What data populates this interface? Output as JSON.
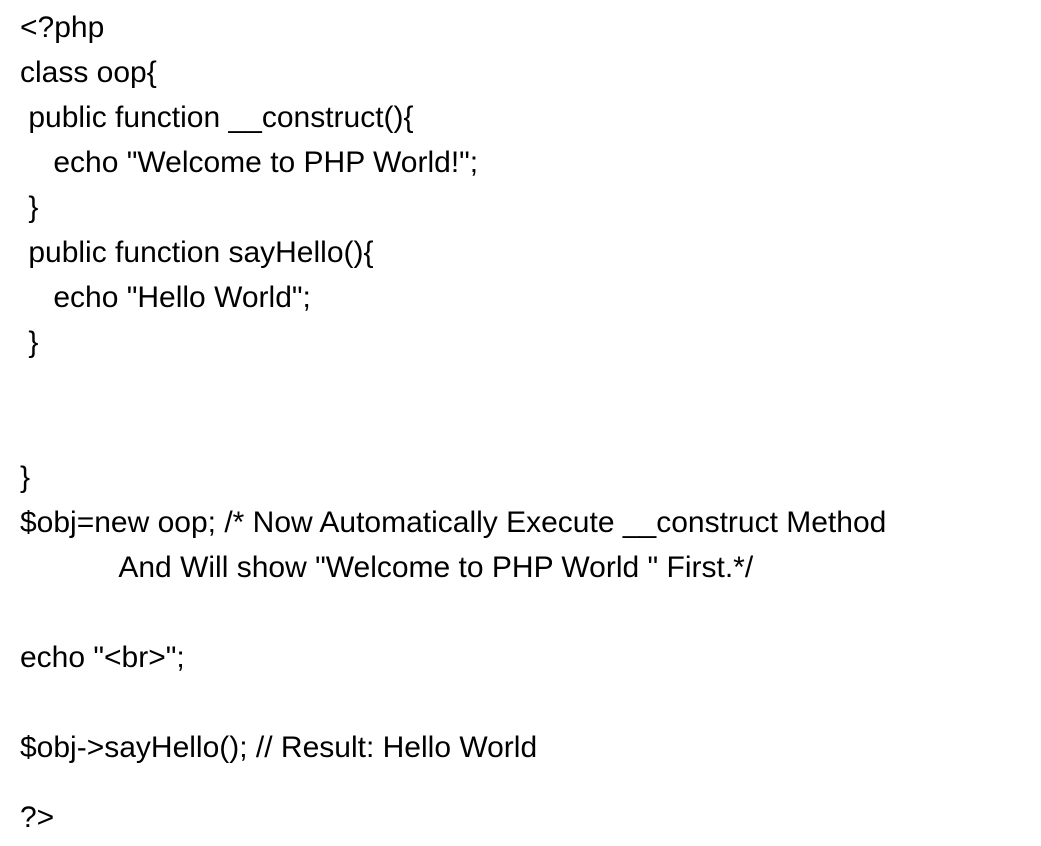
{
  "document": {
    "lines": [
      "<?php",
      "class oop{",
      " public function __construct(){",
      "    echo \"Welcome to PHP World!\";",
      " }",
      " public function sayHello(){",
      "    echo \"Hello World\";",
      " }",
      "}",
      "$obj=new oop; /* Now Automatically Execute __construct Method",
      "            And Will show \"Welcome to PHP World \" First.*/",
      "echo \"<br>\";",
      "$obj->sayHello(); // Result: Hello World",
      "?>"
    ]
  }
}
